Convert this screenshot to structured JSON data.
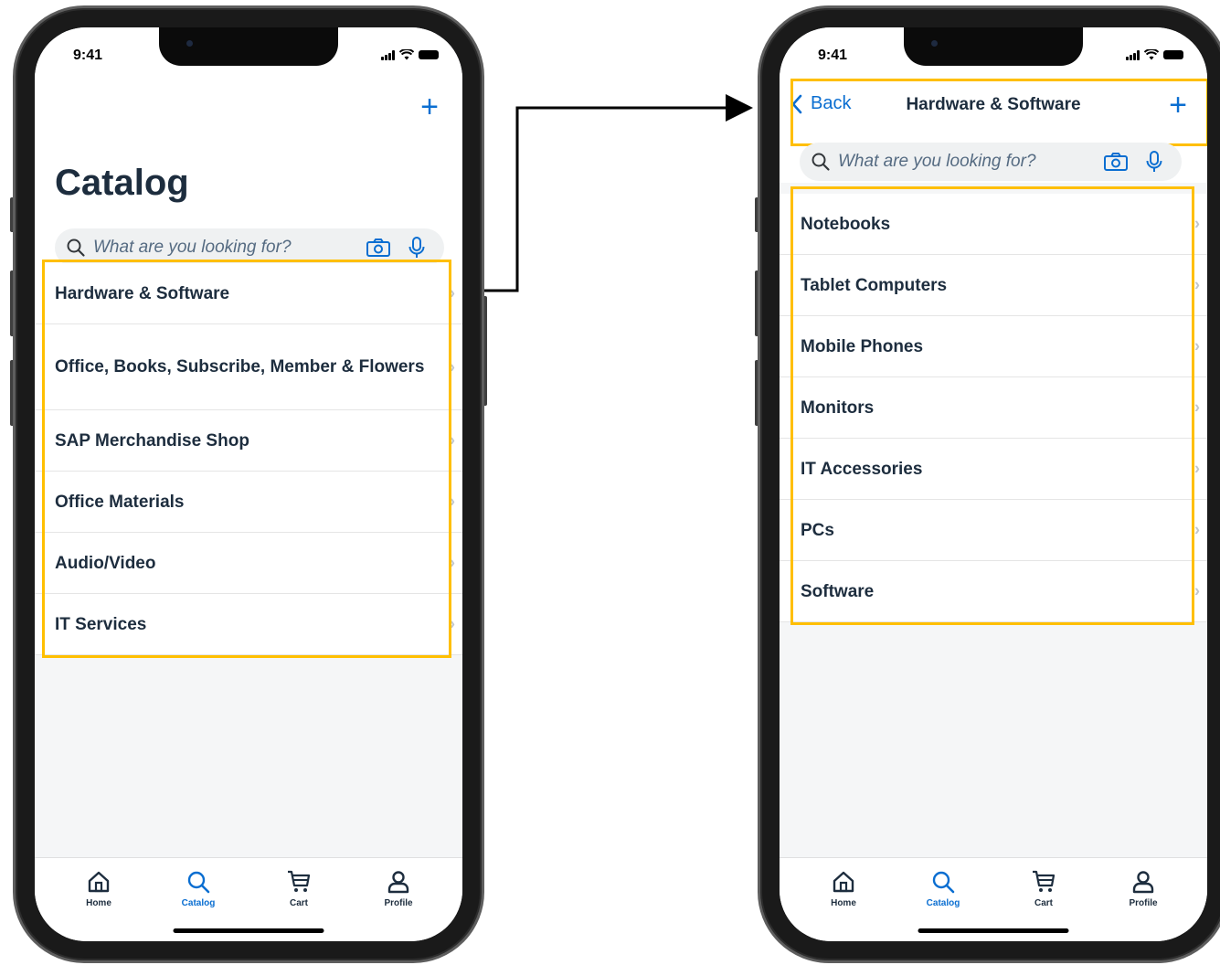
{
  "colors": {
    "accent": "#0a6ed1",
    "highlight": "#ffbf00",
    "text": "#1d2d3e"
  },
  "status": {
    "time": "9:41"
  },
  "left_screen": {
    "title": "Catalog",
    "add_icon": "plus-icon",
    "search": {
      "placeholder": "What are you looking for?"
    },
    "categories": [
      {
        "label": "Hardware & Software"
      },
      {
        "label": "Office, Books, Subscribe, Member & Flowers"
      },
      {
        "label": "SAP Merchandise Shop"
      },
      {
        "label": "Office Materials"
      },
      {
        "label": "Audio/Video"
      },
      {
        "label": "IT Services"
      }
    ]
  },
  "right_screen": {
    "back_label": "Back",
    "title": "Hardware & Software",
    "add_icon": "plus-icon",
    "search": {
      "placeholder": "What are you looking for?"
    },
    "subcategories": [
      {
        "label": "Notebooks"
      },
      {
        "label": "Tablet Computers"
      },
      {
        "label": "Mobile Phones"
      },
      {
        "label": "Monitors"
      },
      {
        "label": "IT Accessories"
      },
      {
        "label": "PCs"
      },
      {
        "label": "Software"
      }
    ]
  },
  "tabbar": {
    "tabs": [
      {
        "label": "Home",
        "icon": "home-icon"
      },
      {
        "label": "Catalog",
        "icon": "search-icon",
        "active": true
      },
      {
        "label": "Cart",
        "icon": "cart-icon"
      },
      {
        "label": "Profile",
        "icon": "profile-icon"
      }
    ]
  }
}
